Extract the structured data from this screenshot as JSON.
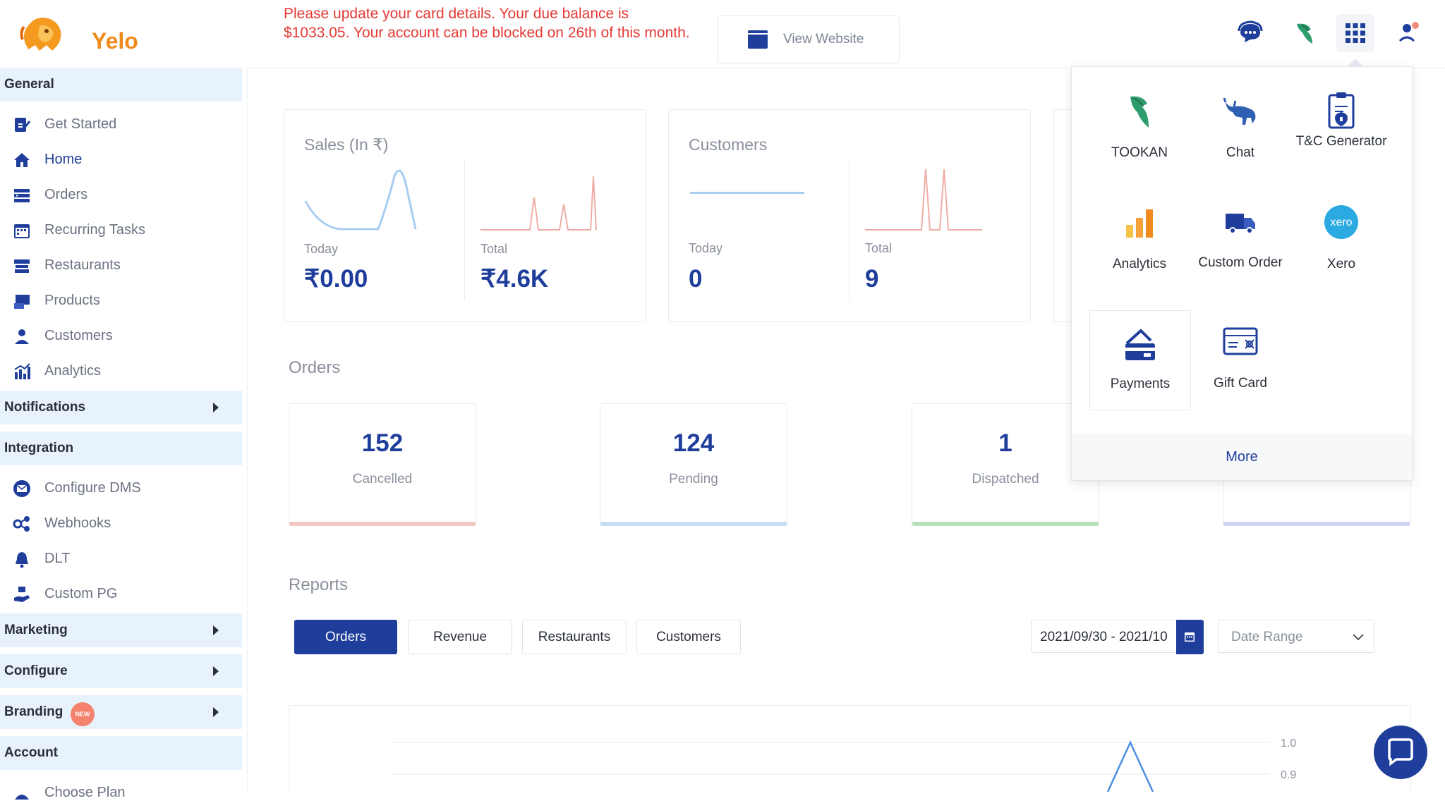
{
  "brand": {
    "name": "Yelo"
  },
  "header": {
    "banner": "Please update your card details. Your due balance is $1033.05. Your account can be blocked on 26th of this month.",
    "view_website": "View Website"
  },
  "sidebar": {
    "general": "General",
    "general_items": [
      {
        "label": "Get Started",
        "icon": "get-started-icon"
      },
      {
        "label": "Home",
        "icon": "home-icon",
        "active": true
      },
      {
        "label": "Orders",
        "icon": "orders-icon"
      },
      {
        "label": "Recurring Tasks",
        "icon": "calendar-icon"
      },
      {
        "label": "Restaurants",
        "icon": "store-icon"
      },
      {
        "label": "Products",
        "icon": "products-icon"
      },
      {
        "label": "Customers",
        "icon": "user-icon"
      },
      {
        "label": "Analytics",
        "icon": "analytics-icon"
      }
    ],
    "notifications": "Notifications",
    "integration": "Integration",
    "integration_items": [
      {
        "label": "Configure DMS",
        "icon": "mail-icon"
      },
      {
        "label": "Webhooks",
        "icon": "webhook-icon"
      },
      {
        "label": "DLT",
        "icon": "bell-icon"
      },
      {
        "label": "Custom PG",
        "icon": "payment-gateway-icon"
      }
    ],
    "marketing": "Marketing",
    "configure": "Configure",
    "branding": "Branding",
    "new_badge": "NEW",
    "account": "Account",
    "choose_plan": "Choose Plan"
  },
  "stats": {
    "sales": {
      "title": "Sales (In ₹)",
      "today_label": "Today",
      "today_value": "₹0.00",
      "total_label": "Total",
      "total_value": "₹4.6K"
    },
    "customers": {
      "title": "Customers",
      "today_label": "Today",
      "today_value": "0",
      "total_label": "Total",
      "total_value": "9"
    }
  },
  "orders": {
    "title": "Orders",
    "cards": [
      {
        "count": "152",
        "status": "Cancelled",
        "color": "#f4c7c3"
      },
      {
        "count": "124",
        "status": "Pending",
        "color": "#c9dcf6"
      },
      {
        "count": "1",
        "status": "Dispatched",
        "color": "#b7e1bd"
      },
      {
        "count": "",
        "status": "",
        "color": "#cfd6f3"
      }
    ]
  },
  "reports": {
    "title": "Reports",
    "tabs": [
      "Orders",
      "Revenue",
      "Restaurants",
      "Customers"
    ],
    "selected_tab": "Orders",
    "date_value": "2021/09/30 - 2021/10",
    "date_range_placeholder": "Date Range",
    "y_ticks": [
      "1.0",
      "0.9"
    ]
  },
  "apps_menu": {
    "apps": [
      {
        "label": "TOOKAN",
        "icon": "tookan-icon"
      },
      {
        "label": "Chat",
        "icon": "chat-bull-icon"
      },
      {
        "label": "T&C Generator",
        "icon": "tnc-generator-icon"
      },
      {
        "label": "Analytics",
        "icon": "analytics-bars-icon"
      },
      {
        "label": "Custom Order",
        "icon": "truck-icon"
      },
      {
        "label": "Xero",
        "icon": "xero-icon",
        "badge": "xero"
      },
      {
        "label": "Payments",
        "icon": "payments-icon",
        "selected": true
      },
      {
        "label": "Gift Card",
        "icon": "gift-card-icon"
      }
    ],
    "more": "More"
  }
}
